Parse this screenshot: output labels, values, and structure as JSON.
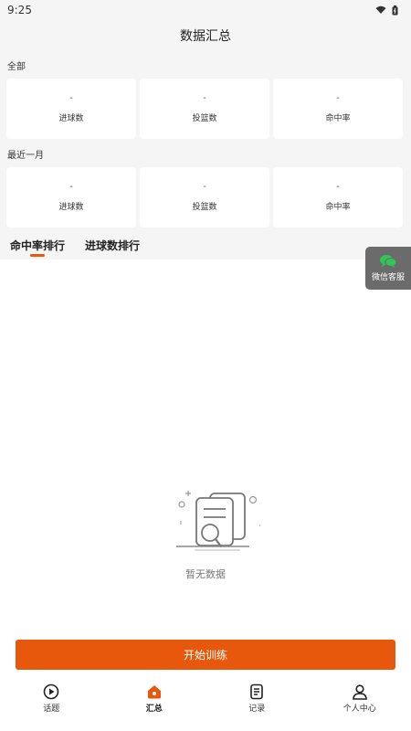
{
  "status_bar": {
    "time": "9:25"
  },
  "header": {
    "title": "数据汇总"
  },
  "sections": [
    {
      "label": "全部",
      "stats": [
        {
          "value": "-",
          "label": "进球数"
        },
        {
          "value": "-",
          "label": "投篮数"
        },
        {
          "value": "-",
          "label": "命中率"
        }
      ]
    },
    {
      "label": "最近一月",
      "stats": [
        {
          "value": "-",
          "label": "进球数"
        },
        {
          "value": "-",
          "label": "投篮数"
        },
        {
          "value": "-",
          "label": "命中率"
        }
      ]
    }
  ],
  "tabs": [
    {
      "label": "命中率排行",
      "active": true
    },
    {
      "label": "进球数排行",
      "active": false
    }
  ],
  "service": {
    "label": "微信客服",
    "icon": "wechat-icon"
  },
  "empty_state": {
    "text": "暂无数据",
    "icon": "empty-document-icon"
  },
  "start_button": {
    "label": "开始训练"
  },
  "bottom_nav": [
    {
      "label": "话题",
      "icon": "play-circle-icon",
      "active": false
    },
    {
      "label": "汇总",
      "icon": "home-icon",
      "active": true
    },
    {
      "label": "记录",
      "icon": "document-icon",
      "active": false
    },
    {
      "label": "个人中心",
      "icon": "user-icon",
      "active": false
    }
  ],
  "colors": {
    "accent": "#e8580c",
    "background": "#f5f5f5",
    "service_bg": "#6b6b6b",
    "wechat_green": "#2fc654"
  }
}
